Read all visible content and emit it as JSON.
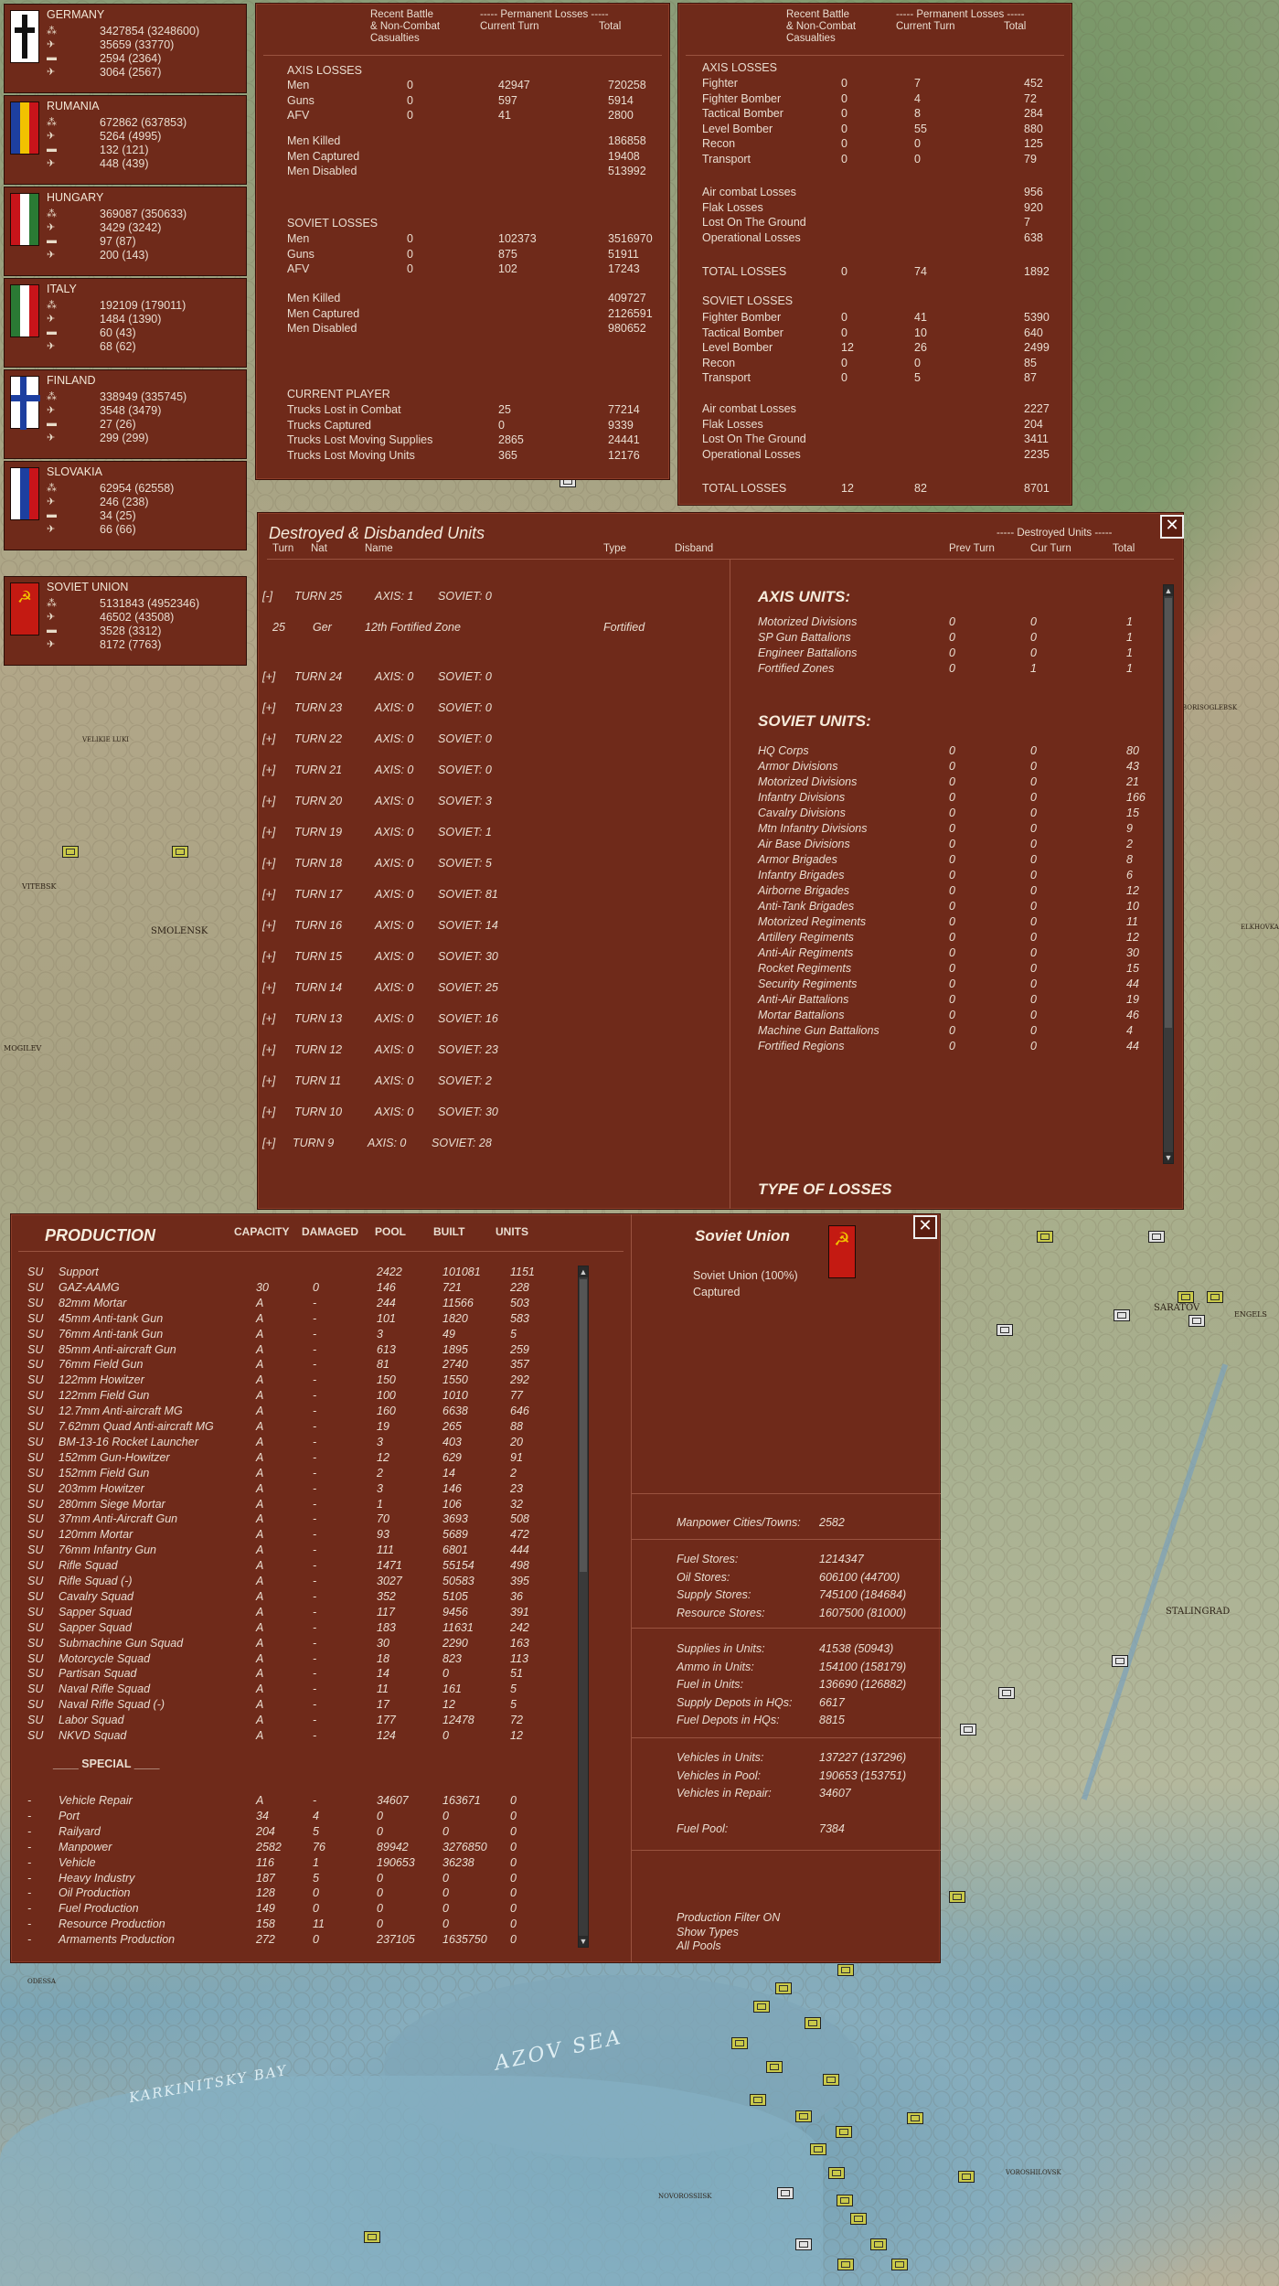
{
  "nations": [
    {
      "name": "GERMANY",
      "values": [
        "3427854 (3248600)",
        "35659 (33770)",
        "2594 (2364)",
        "3064 (2567)"
      ]
    },
    {
      "name": "RUMANIA",
      "values": [
        "672862 (637853)",
        "5264 (4995)",
        "132 (121)",
        "448 (439)"
      ]
    },
    {
      "name": "HUNGARY",
      "values": [
        "369087 (350633)",
        "3429 (3242)",
        "97 (87)",
        "200 (143)"
      ]
    },
    {
      "name": "ITALY",
      "values": [
        "192109 (179011)",
        "1484 (1390)",
        "60 (43)",
        "68 (62)"
      ]
    },
    {
      "name": "FINLAND",
      "values": [
        "338949 (335745)",
        "3548 (3479)",
        "27 (26)",
        "299 (299)"
      ]
    },
    {
      "name": "SLOVAKIA",
      "values": [
        "62954 (62558)",
        "246 (238)",
        "34 (25)",
        "66 (66)"
      ]
    },
    {
      "name": "SOVIET UNION",
      "values": [
        "5131843 (4952346)",
        "46502 (43508)",
        "3528 (3312)",
        "8172 (7763)"
      ]
    }
  ],
  "ground_losses": {
    "header": {
      "recent": "Recent Battle\n& Non-Combat\nCasualties",
      "perm": "----- Permanent Losses -----",
      "cur": "Current Turn",
      "total": "Total"
    },
    "axis_title": "AXIS LOSSES",
    "axis": [
      [
        "Men",
        "0",
        "42947",
        "720258"
      ],
      [
        "Guns",
        "0",
        "597",
        "5914"
      ],
      [
        "AFV",
        "0",
        "41",
        "2800"
      ]
    ],
    "axis2": [
      [
        "Men Killed",
        "",
        "",
        "186858"
      ],
      [
        "Men Captured",
        "",
        "",
        "19408"
      ],
      [
        "Men Disabled",
        "",
        "",
        "513992"
      ]
    ],
    "soviet_title": "SOVIET LOSSES",
    "soviet": [
      [
        "Men",
        "0",
        "102373",
        "3516970"
      ],
      [
        "Guns",
        "0",
        "875",
        "51911"
      ],
      [
        "AFV",
        "0",
        "102",
        "17243"
      ]
    ],
    "soviet2": [
      [
        "Men Killed",
        "",
        "",
        "409727"
      ],
      [
        "Men Captured",
        "",
        "",
        "2126591"
      ],
      [
        "Men Disabled",
        "",
        "",
        "980652"
      ]
    ],
    "cp_title": "CURRENT PLAYER",
    "cp": [
      [
        "Trucks Lost in Combat",
        "",
        "25",
        "77214"
      ],
      [
        "Trucks Captured",
        "",
        "0",
        "9339"
      ],
      [
        "Trucks Lost Moving Supplies",
        "",
        "2865",
        "24441"
      ],
      [
        "Trucks Lost Moving Units",
        "",
        "365",
        "12176"
      ]
    ]
  },
  "air_losses": {
    "header": {
      "recent": "Recent Battle\n& Non-Combat\nCasualties",
      "perm": "----- Permanent Losses -----",
      "cur": "Current Turn",
      "total": "Total"
    },
    "axis_title": "AXIS LOSSES",
    "axis": [
      [
        "Fighter",
        "0",
        "7",
        "452"
      ],
      [
        "Fighter Bomber",
        "0",
        "4",
        "72"
      ],
      [
        "Tactical Bomber",
        "0",
        "8",
        "284"
      ],
      [
        "Level Bomber",
        "0",
        "55",
        "880"
      ],
      [
        "Recon",
        "0",
        "0",
        "125"
      ],
      [
        "Transport",
        "0",
        "0",
        "79"
      ]
    ],
    "axis2": [
      [
        "Air combat Losses",
        "",
        "",
        "956"
      ],
      [
        "Flak Losses",
        "",
        "",
        "920"
      ],
      [
        "Lost On The Ground",
        "",
        "",
        "7"
      ],
      [
        "Operational Losses",
        "",
        "",
        "638"
      ]
    ],
    "axis_total": [
      "TOTAL LOSSES",
      "0",
      "74",
      "1892"
    ],
    "soviet_title": "SOVIET LOSSES",
    "soviet": [
      [
        "Fighter Bomber",
        "0",
        "41",
        "5390"
      ],
      [
        "Tactical Bomber",
        "0",
        "10",
        "640"
      ],
      [
        "Level Bomber",
        "12",
        "26",
        "2499"
      ],
      [
        "Recon",
        "0",
        "0",
        "85"
      ],
      [
        "Transport",
        "0",
        "5",
        "87"
      ]
    ],
    "soviet2": [
      [
        "Air combat Losses",
        "",
        "",
        "2227"
      ],
      [
        "Flak Losses",
        "",
        "",
        "204"
      ],
      [
        "Lost On The Ground",
        "",
        "",
        "3411"
      ],
      [
        "Operational Losses",
        "",
        "",
        "2235"
      ]
    ],
    "soviet_total": [
      "TOTAL LOSSES",
      "12",
      "82",
      "8701"
    ]
  },
  "destroyed": {
    "title": "Destroyed & Disbanded Units",
    "cols": [
      "Turn",
      "Nat",
      "Name",
      "Type",
      "Disband"
    ],
    "right_hdr": "----- Destroyed Units -----",
    "right_cols": [
      "Prev Turn",
      "Cur Turn",
      "Total"
    ],
    "turns": [
      {
        "exp": "[-]",
        "turn": "TURN 25",
        "axis": "AXIS: 1",
        "soviet": "SOVIET: 0"
      },
      {
        "exp": "[+]",
        "turn": "TURN 24",
        "axis": "AXIS: 0",
        "soviet": "SOVIET: 0"
      },
      {
        "exp": "[+]",
        "turn": "TURN 23",
        "axis": "AXIS: 0",
        "soviet": "SOVIET: 0"
      },
      {
        "exp": "[+]",
        "turn": "TURN 22",
        "axis": "AXIS: 0",
        "soviet": "SOVIET: 0"
      },
      {
        "exp": "[+]",
        "turn": "TURN 21",
        "axis": "AXIS: 0",
        "soviet": "SOVIET: 0"
      },
      {
        "exp": "[+]",
        "turn": "TURN 20",
        "axis": "AXIS: 0",
        "soviet": "SOVIET: 3"
      },
      {
        "exp": "[+]",
        "turn": "TURN 19",
        "axis": "AXIS: 0",
        "soviet": "SOVIET: 1"
      },
      {
        "exp": "[+]",
        "turn": "TURN 18",
        "axis": "AXIS: 0",
        "soviet": "SOVIET: 5"
      },
      {
        "exp": "[+]",
        "turn": "TURN 17",
        "axis": "AXIS: 0",
        "soviet": "SOVIET: 81"
      },
      {
        "exp": "[+]",
        "turn": "TURN 16",
        "axis": "AXIS: 0",
        "soviet": "SOVIET: 14"
      },
      {
        "exp": "[+]",
        "turn": "TURN 15",
        "axis": "AXIS: 0",
        "soviet": "SOVIET: 30"
      },
      {
        "exp": "[+]",
        "turn": "TURN 14",
        "axis": "AXIS: 0",
        "soviet": "SOVIET: 25"
      },
      {
        "exp": "[+]",
        "turn": "TURN 13",
        "axis": "AXIS: 0",
        "soviet": "SOVIET: 16"
      },
      {
        "exp": "[+]",
        "turn": "TURN 12",
        "axis": "AXIS: 0",
        "soviet": "SOVIET: 23"
      },
      {
        "exp": "[+]",
        "turn": "TURN 11",
        "axis": "AXIS: 0",
        "soviet": "SOVIET: 2"
      },
      {
        "exp": "[+]",
        "turn": "TURN 10",
        "axis": "AXIS: 0",
        "soviet": "SOVIET: 30"
      },
      {
        "exp": "[+]",
        "turn": "TURN 9",
        "axis": "AXIS: 0",
        "soviet": "SOVIET: 28"
      }
    ],
    "detail": {
      "turn": "25",
      "nat": "Ger",
      "name": "12th Fortified Zone",
      "type": "Fortified"
    },
    "axis_units_title": "AXIS UNITS:",
    "axis_units": [
      [
        "Motorized Divisions",
        "0",
        "0",
        "1"
      ],
      [
        "SP Gun Battalions",
        "0",
        "0",
        "1"
      ],
      [
        "Engineer Battalions",
        "0",
        "0",
        "1"
      ],
      [
        "Fortified Zones",
        "0",
        "1",
        "1"
      ]
    ],
    "soviet_units_title": "SOVIET UNITS:",
    "soviet_units": [
      [
        "HQ Corps",
        "0",
        "0",
        "80"
      ],
      [
        "Armor Divisions",
        "0",
        "0",
        "43"
      ],
      [
        "Motorized Divisions",
        "0",
        "0",
        "21"
      ],
      [
        "Infantry Divisions",
        "0",
        "0",
        "166"
      ],
      [
        "Cavalry Divisions",
        "0",
        "0",
        "15"
      ],
      [
        "Mtn Infantry Divisions",
        "0",
        "0",
        "9"
      ],
      [
        "Air Base Divisions",
        "0",
        "0",
        "2"
      ],
      [
        "Armor Brigades",
        "0",
        "0",
        "8"
      ],
      [
        "Infantry Brigades",
        "0",
        "0",
        "6"
      ],
      [
        "Airborne Brigades",
        "0",
        "0",
        "12"
      ],
      [
        "Anti-Tank Brigades",
        "0",
        "0",
        "10"
      ],
      [
        "Motorized Regiments",
        "0",
        "0",
        "11"
      ],
      [
        "Artillery Regiments",
        "0",
        "0",
        "12"
      ],
      [
        "Anti-Air Regiments",
        "0",
        "0",
        "30"
      ],
      [
        "Rocket Regiments",
        "0",
        "0",
        "15"
      ],
      [
        "Security Regiments",
        "0",
        "0",
        "44"
      ],
      [
        "Anti-Air Battalions",
        "0",
        "0",
        "19"
      ],
      [
        "Mortar Battalions",
        "0",
        "0",
        "46"
      ],
      [
        "Machine Gun Battalions",
        "0",
        "0",
        "4"
      ],
      [
        "Fortified Regions",
        "0",
        "0",
        "44"
      ]
    ],
    "type_of_losses": "TYPE OF LOSSES"
  },
  "production": {
    "title": "PRODUCTION",
    "cols": [
      "CAPACITY",
      "DAMAGED",
      "POOL",
      "BUILT",
      "UNITS"
    ],
    "items": [
      [
        "SU",
        "Support",
        "",
        "",
        "2422",
        "101081",
        "1151"
      ],
      [
        "SU",
        "GAZ-AAMG",
        "30",
        "0",
        "146",
        "721",
        "228"
      ],
      [
        "SU",
        "82mm Mortar",
        "A",
        "-",
        "244",
        "11566",
        "503"
      ],
      [
        "SU",
        "45mm Anti-tank Gun",
        "A",
        "-",
        "101",
        "1820",
        "583"
      ],
      [
        "SU",
        "76mm Anti-tank Gun",
        "A",
        "-",
        "3",
        "49",
        "5"
      ],
      [
        "SU",
        "85mm Anti-aircraft Gun",
        "A",
        "-",
        "613",
        "1895",
        "259"
      ],
      [
        "SU",
        "76mm Field Gun",
        "A",
        "-",
        "81",
        "2740",
        "357"
      ],
      [
        "SU",
        "122mm Howitzer",
        "A",
        "-",
        "150",
        "1550",
        "292"
      ],
      [
        "SU",
        "122mm Field Gun",
        "A",
        "-",
        "100",
        "1010",
        "77"
      ],
      [
        "SU",
        "12.7mm Anti-aircraft MG",
        "A",
        "-",
        "160",
        "6638",
        "646"
      ],
      [
        "SU",
        "7.62mm Quad Anti-aircraft MG",
        "A",
        "-",
        "19",
        "265",
        "88"
      ],
      [
        "SU",
        "BM-13-16 Rocket Launcher",
        "A",
        "-",
        "3",
        "403",
        "20"
      ],
      [
        "SU",
        "152mm Gun-Howitzer",
        "A",
        "-",
        "12",
        "629",
        "91"
      ],
      [
        "SU",
        "152mm Field Gun",
        "A",
        "-",
        "2",
        "14",
        "2"
      ],
      [
        "SU",
        "203mm Howitzer",
        "A",
        "-",
        "3",
        "146",
        "23"
      ],
      [
        "SU",
        "280mm Siege Mortar",
        "A",
        "-",
        "1",
        "106",
        "32"
      ],
      [
        "SU",
        "37mm Anti-Aircraft Gun",
        "A",
        "-",
        "70",
        "3693",
        "508"
      ],
      [
        "SU",
        "120mm Mortar",
        "A",
        "-",
        "93",
        "5689",
        "472"
      ],
      [
        "SU",
        "76mm Infantry Gun",
        "A",
        "-",
        "111",
        "6801",
        "444"
      ],
      [
        "SU",
        "Rifle Squad",
        "A",
        "-",
        "1471",
        "55154",
        "498"
      ],
      [
        "SU",
        "Rifle Squad (-)",
        "A",
        "-",
        "3027",
        "50583",
        "395"
      ],
      [
        "SU",
        "Cavalry Squad",
        "A",
        "-",
        "352",
        "5105",
        "36"
      ],
      [
        "SU",
        "Sapper Squad",
        "A",
        "-",
        "117",
        "9456",
        "391"
      ],
      [
        "SU",
        "Sapper Squad",
        "A",
        "-",
        "183",
        "11631",
        "242"
      ],
      [
        "SU",
        "Submachine Gun Squad",
        "A",
        "-",
        "30",
        "2290",
        "163"
      ],
      [
        "SU",
        "Motorcycle Squad",
        "A",
        "-",
        "18",
        "823",
        "113"
      ],
      [
        "SU",
        "Partisan Squad",
        "A",
        "-",
        "14",
        "0",
        "51"
      ],
      [
        "SU",
        "Naval Rifle Squad",
        "A",
        "-",
        "11",
        "161",
        "5"
      ],
      [
        "SU",
        "Naval Rifle Squad (-)",
        "A",
        "-",
        "17",
        "12",
        "5"
      ],
      [
        "SU",
        "Labor Squad",
        "A",
        "-",
        "177",
        "12478",
        "72"
      ],
      [
        "SU",
        "NKVD Squad",
        "A",
        "-",
        "124",
        "0",
        "12"
      ]
    ],
    "special_title": "____ SPECIAL ____",
    "special": [
      [
        "-",
        "Vehicle Repair",
        "A",
        "-",
        "34607",
        "163671",
        "0"
      ],
      [
        "-",
        "Port",
        "34",
        "4",
        "0",
        "0",
        "0"
      ],
      [
        "-",
        "Railyard",
        "204",
        "5",
        "0",
        "0",
        "0"
      ],
      [
        "-",
        "Manpower",
        "2582",
        "76",
        "89942",
        "3276850",
        "0"
      ],
      [
        "-",
        "Vehicle",
        "116",
        "1",
        "190653",
        "36238",
        "0"
      ],
      [
        "-",
        "Heavy Industry",
        "187",
        "5",
        "0",
        "0",
        "0"
      ],
      [
        "-",
        "Oil Production",
        "128",
        "0",
        "0",
        "0",
        "0"
      ],
      [
        "-",
        "Fuel Production",
        "149",
        "0",
        "0",
        "0",
        "0"
      ],
      [
        "-",
        "Resource Production",
        "158",
        "11",
        "0",
        "0",
        "0"
      ],
      [
        "-",
        "Armaments Production",
        "272",
        "0",
        "237105",
        "1635750",
        "0"
      ]
    ],
    "side": {
      "title": "Soviet Union",
      "sub1": "Soviet Union  (100%)",
      "sub2": "Captured",
      "g1": [
        [
          "Manpower Cities/Towns:",
          "2582"
        ]
      ],
      "g2": [
        [
          "Fuel Stores:",
          "1214347"
        ],
        [
          "Oil Stores:",
          "606100 (44700)"
        ],
        [
          "Supply Stores:",
          "745100 (184684)"
        ],
        [
          "Resource Stores:",
          "1607500 (81000)"
        ]
      ],
      "g3": [
        [
          "Supplies in Units:",
          "41538 (50943)"
        ],
        [
          "Ammo in Units:",
          "154100 (158179)"
        ],
        [
          "Fuel in Units:",
          "136690 (126882)"
        ],
        [
          "Supply Depots in HQs:",
          "6617"
        ],
        [
          "Fuel Depots in HQs:",
          "8815"
        ]
      ],
      "g4": [
        [
          "Vehicles in Units:",
          "137227 (137296)"
        ],
        [
          "Vehicles in Pool:",
          "190653 (153751)"
        ],
        [
          "Vehicles in Repair:",
          "34607"
        ],
        [
          "",
          ""
        ],
        [
          "Fuel Pool:",
          "7384"
        ]
      ],
      "footer": [
        "Production Filter ON",
        "Show Types",
        "All Pools"
      ]
    }
  },
  "map_labels": [
    "Smolensk",
    "Vitebsk",
    "Mogilev",
    "Velikie Luki",
    "Saratov",
    "Stalingrad",
    "Azov Sea",
    "Karkinitsky Bay",
    "Voroshilovsk",
    "Novorossiisk",
    "Odessa",
    "Engels",
    "Borisoglebsk",
    "Elkhovka"
  ],
  "close_icon": "✕",
  "colors": {
    "panel": "#6f2a1a",
    "panel_dark": "#5b2113",
    "text": "#e9ddd0"
  }
}
